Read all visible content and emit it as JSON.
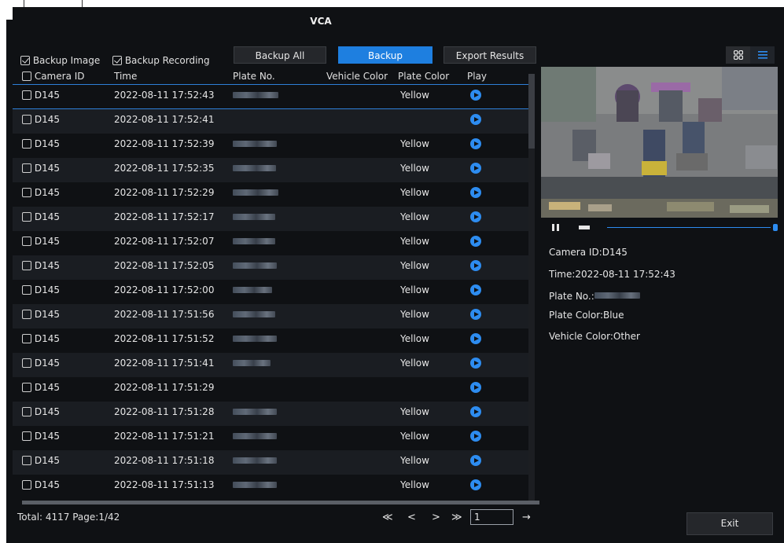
{
  "window": {
    "title": "VCA"
  },
  "toolbar": {
    "backup_image_label": "Backup Image",
    "backup_recording_label": "Backup Recording",
    "backup_all_label": "Backup All",
    "backup_label": "Backup",
    "export_label": "Export Results",
    "grid_view_icon": "grid-icon",
    "list_view_icon": "list-icon",
    "accent_color": "#1e7fe0"
  },
  "table": {
    "headers": {
      "camera_id": "Camera ID",
      "time": "Time",
      "plate_no": "Plate No.",
      "vehicle_color": "Vehicle Color",
      "plate_color": "Plate Color",
      "play": "Play"
    },
    "rows": [
      {
        "camera": "D145",
        "time": "2022-08-11 17:52:43",
        "plate_blurred": true,
        "plate_color": "Yellow"
      },
      {
        "camera": "D145",
        "time": "2022-08-11 17:52:41",
        "plate_blurred": false,
        "plate_color": ""
      },
      {
        "camera": "D145",
        "time": "2022-08-11 17:52:39",
        "plate_blurred": true,
        "plate_color": "Yellow"
      },
      {
        "camera": "D145",
        "time": "2022-08-11 17:52:35",
        "plate_blurred": true,
        "plate_color": "Yellow"
      },
      {
        "camera": "D145",
        "time": "2022-08-11 17:52:29",
        "plate_blurred": true,
        "plate_color": "Yellow"
      },
      {
        "camera": "D145",
        "time": "2022-08-11 17:52:17",
        "plate_blurred": true,
        "plate_color": "Yellow"
      },
      {
        "camera": "D145",
        "time": "2022-08-11 17:52:07",
        "plate_blurred": true,
        "plate_color": "Yellow"
      },
      {
        "camera": "D145",
        "time": "2022-08-11 17:52:05",
        "plate_blurred": true,
        "plate_color": "Yellow"
      },
      {
        "camera": "D145",
        "time": "2022-08-11 17:52:00",
        "plate_blurred": true,
        "plate_color": "Yellow"
      },
      {
        "camera": "D145",
        "time": "2022-08-11 17:51:56",
        "plate_blurred": true,
        "plate_color": "Yellow"
      },
      {
        "camera": "D145",
        "time": "2022-08-11 17:51:52",
        "plate_blurred": true,
        "plate_color": "Yellow"
      },
      {
        "camera": "D145",
        "time": "2022-08-11 17:51:41",
        "plate_blurred": true,
        "plate_color": "Yellow"
      },
      {
        "camera": "D145",
        "time": "2022-08-11 17:51:29",
        "plate_blurred": false,
        "plate_color": ""
      },
      {
        "camera": "D145",
        "time": "2022-08-11 17:51:28",
        "plate_blurred": true,
        "plate_color": "Yellow"
      },
      {
        "camera": "D145",
        "time": "2022-08-11 17:51:21",
        "plate_blurred": true,
        "plate_color": "Yellow"
      },
      {
        "camera": "D145",
        "time": "2022-08-11 17:51:18",
        "plate_blurred": true,
        "plate_color": "Yellow"
      },
      {
        "camera": "D145",
        "time": "2022-08-11 17:51:13",
        "plate_blurred": true,
        "plate_color": "Yellow"
      }
    ]
  },
  "footer": {
    "total_text": "Total: 4117  Page:1/42",
    "first_page": "≪",
    "prev_page": "<",
    "next_page": ">",
    "last_page": "≫",
    "page_value": "1",
    "go": "→"
  },
  "details": {
    "camera_id": "Camera ID:D145",
    "time": "Time:2022-08-11 17:52:43",
    "plate_no_label": "Plate No.:",
    "plate_color": "Plate Color:Blue",
    "vehicle_color": "Vehicle Color:Other"
  },
  "playback": {
    "progress": 1.0
  },
  "exit_label": "Exit"
}
